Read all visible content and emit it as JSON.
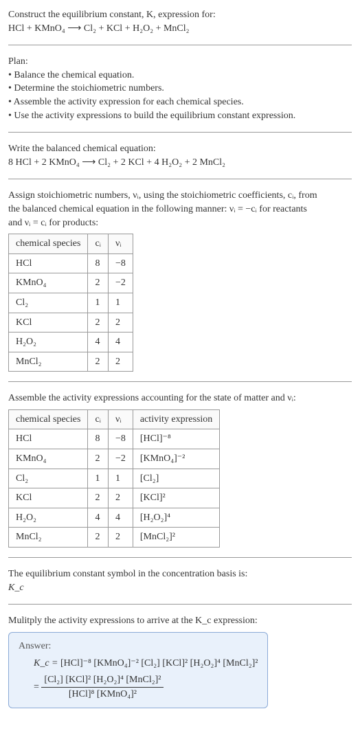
{
  "title": {
    "line1": "Construct the equilibrium constant, K, expression for:"
  },
  "unbalanced": "HCl + KMnO₄  ⟶  Cl₂ + KCl + H₂O₂ + MnCl₂",
  "plan": {
    "heading": "Plan:",
    "items": [
      "• Balance the chemical equation.",
      "• Determine the stoichiometric numbers.",
      "• Assemble the activity expression for each chemical species.",
      "• Use the activity expressions to build the equilibrium constant expression."
    ]
  },
  "balanced_heading": "Write the balanced chemical equation:",
  "balanced": "8 HCl + 2 KMnO₄  ⟶  Cl₂ + 2 KCl + 4 H₂O₂ + 2 MnCl₂",
  "stoich_text": {
    "line1": "Assign stoichiometric numbers, νᵢ, using the stoichiometric coefficients, cᵢ, from",
    "line2": "the balanced chemical equation in the following manner: νᵢ = −cᵢ for reactants",
    "line3": "and νᵢ = cᵢ for products:"
  },
  "table1": {
    "headers": [
      "chemical species",
      "cᵢ",
      "νᵢ"
    ],
    "rows": [
      [
        "HCl",
        "8",
        "−8"
      ],
      [
        "KMnO₄",
        "2",
        "−2"
      ],
      [
        "Cl₂",
        "1",
        "1"
      ],
      [
        "KCl",
        "2",
        "2"
      ],
      [
        "H₂O₂",
        "4",
        "4"
      ],
      [
        "MnCl₂",
        "2",
        "2"
      ]
    ]
  },
  "activity_heading": "Assemble the activity expressions accounting for the state of matter and νᵢ:",
  "table2": {
    "headers": [
      "chemical species",
      "cᵢ",
      "νᵢ",
      "activity expression"
    ],
    "rows": [
      [
        "HCl",
        "8",
        "−8",
        "[HCl]⁻⁸"
      ],
      [
        "KMnO₄",
        "2",
        "−2",
        "[KMnO₄]⁻²"
      ],
      [
        "Cl₂",
        "1",
        "1",
        "[Cl₂]"
      ],
      [
        "KCl",
        "2",
        "2",
        "[KCl]²"
      ],
      [
        "H₂O₂",
        "4",
        "4",
        "[H₂O₂]⁴"
      ],
      [
        "MnCl₂",
        "2",
        "2",
        "[MnCl₂]²"
      ]
    ]
  },
  "basis_line1": "The equilibrium constant symbol in the concentration basis is:",
  "basis_line2": "K_c",
  "multiply_heading": "Mulitply the activity expressions to arrive at the K_c expression:",
  "answer": {
    "label": "Answer:",
    "eq_lhs": "K_c =",
    "eq_rhs_flat": "[HCl]⁻⁸ [KMnO₄]⁻² [Cl₂] [KCl]² [H₂O₂]⁴ [MnCl₂]²",
    "frac_num": "[Cl₂] [KCl]² [H₂O₂]⁴ [MnCl₂]²",
    "frac_den": "[HCl]⁸ [KMnO₄]²"
  },
  "chart_data": {
    "type": "table",
    "tables": [
      {
        "title": "Stoichiometric numbers",
        "columns": [
          "chemical species",
          "c_i",
          "nu_i"
        ],
        "rows": [
          [
            "HCl",
            8,
            -8
          ],
          [
            "KMnO4",
            2,
            -2
          ],
          [
            "Cl2",
            1,
            1
          ],
          [
            "KCl",
            2,
            2
          ],
          [
            "H2O2",
            4,
            4
          ],
          [
            "MnCl2",
            2,
            2
          ]
        ]
      },
      {
        "title": "Activity expressions",
        "columns": [
          "chemical species",
          "c_i",
          "nu_i",
          "activity expression"
        ],
        "rows": [
          [
            "HCl",
            8,
            -8,
            "[HCl]^-8"
          ],
          [
            "KMnO4",
            2,
            -2,
            "[KMnO4]^-2"
          ],
          [
            "Cl2",
            1,
            1,
            "[Cl2]"
          ],
          [
            "KCl",
            2,
            2,
            "[KCl]^2"
          ],
          [
            "H2O2",
            4,
            4,
            "[H2O2]^4"
          ],
          [
            "MnCl2",
            2,
            2,
            "[MnCl2]^2"
          ]
        ]
      }
    ]
  }
}
